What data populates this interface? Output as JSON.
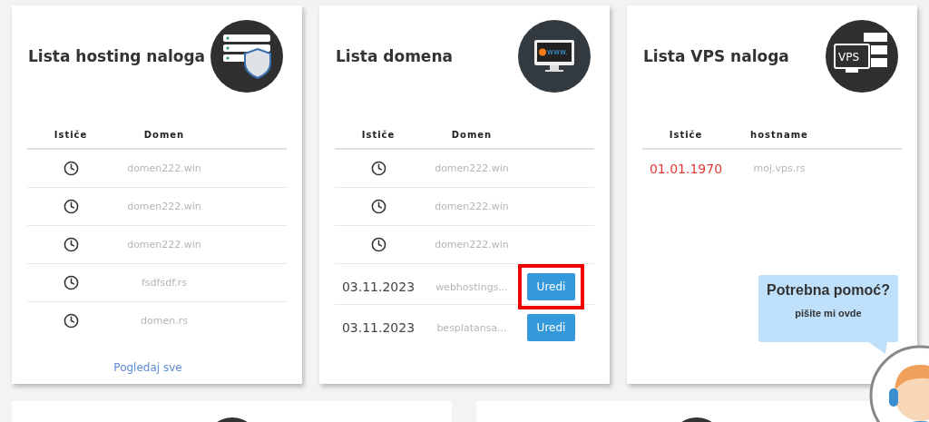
{
  "cards": [
    {
      "kind": "hosting",
      "title": "Lista hosting naloga",
      "columns": [
        "Ističe",
        "Domen"
      ],
      "rows": [
        {
          "expires": {
            "kind": "clock"
          },
          "name": "domen222.win"
        },
        {
          "expires": {
            "kind": "clock"
          },
          "name": "domen222.win"
        },
        {
          "expires": {
            "kind": "clock"
          },
          "name": "domen222.win"
        },
        {
          "expires": {
            "kind": "clock"
          },
          "name": "fsdfsdf.rs"
        },
        {
          "expires": {
            "kind": "clock"
          },
          "name": "domen.rs"
        }
      ],
      "footer_link": "Pogledaj sve"
    },
    {
      "kind": "domain",
      "title": "Lista domena",
      "icon_text": "www.",
      "columns": [
        "Ističe",
        "Domen"
      ],
      "rows": [
        {
          "expires": {
            "kind": "clock"
          },
          "name": "domen222.win"
        },
        {
          "expires": {
            "kind": "clock"
          },
          "name": "domen222.win"
        },
        {
          "expires": {
            "kind": "clock"
          },
          "name": "domen222.win"
        },
        {
          "expires": {
            "kind": "date",
            "text": "03.11.2023",
            "overdue": false
          },
          "name": "webhostings...",
          "action": "Uredi",
          "highlighted": true
        },
        {
          "expires": {
            "kind": "date",
            "text": "03.11.2023",
            "overdue": false
          },
          "name": "besplatansa...",
          "action": "Uredi",
          "highlighted": false
        }
      ]
    },
    {
      "kind": "vps",
      "title": "Lista VPS naloga",
      "icon_text": "VPS",
      "columns": [
        "Ističe",
        "hostname"
      ],
      "rows": [
        {
          "expires": {
            "kind": "date",
            "text": "01.01.1970",
            "overdue": true
          },
          "name": "moj.vps.rs"
        }
      ]
    }
  ],
  "help_widget": {
    "title": "Potrebna pomoć?",
    "subtitle": "pišite mi ovde"
  }
}
